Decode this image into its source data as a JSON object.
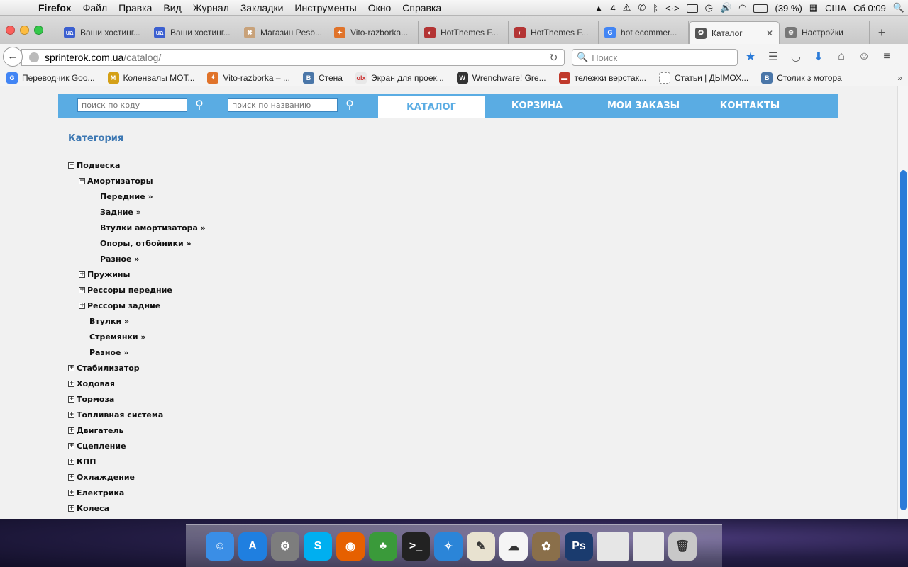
{
  "menubar": {
    "app": "Firefox",
    "items": [
      "Файл",
      "Правка",
      "Вид",
      "Журнал",
      "Закладки",
      "Инструменты",
      "Окно",
      "Справка"
    ],
    "status": {
      "notif": "4",
      "battery": "(39 %)",
      "input": "США",
      "clock": "Сб 0:09"
    }
  },
  "tabs": [
    {
      "label": "Ваши хостинг...",
      "fav_text": "ua",
      "fav_color": "#3b5fd0"
    },
    {
      "label": "Ваши хостинг...",
      "fav_text": "ua",
      "fav_color": "#3b5fd0"
    },
    {
      "label": "Магазин Pesb...",
      "fav_text": "✖",
      "fav_color": "#c8a27a"
    },
    {
      "label": "Vito-razborka...",
      "fav_text": "✦",
      "fav_color": "#e0732a"
    },
    {
      "label": "HotThemes F...",
      "fav_text": "◐",
      "fav_color": "#b33434"
    },
    {
      "label": "HotThemes F...",
      "fav_text": "◐",
      "fav_color": "#b33434"
    },
    {
      "label": "hot ecommer...",
      "fav_text": "G",
      "fav_color": "#4285f4"
    },
    {
      "label": "Каталог",
      "fav_text": "✪",
      "fav_color": "#555555",
      "active": true
    },
    {
      "label": "Настройки",
      "fav_text": "⚙",
      "fav_color": "#777777"
    }
  ],
  "navbar": {
    "url_host": "sprinterok.com.ua",
    "url_path": "/catalog/",
    "search_placeholder": "Поиск"
  },
  "bookmarks": [
    {
      "label": "Переводчик Goo...",
      "fav_text": "G",
      "fav_color": "#4285f4"
    },
    {
      "label": "Коленвалы МОТ...",
      "fav_text": "M",
      "fav_color": "#d4a017"
    },
    {
      "label": "Vito-razborka – ...",
      "fav_text": "✦",
      "fav_color": "#e0732a"
    },
    {
      "label": "Стена",
      "fav_text": "B",
      "fav_color": "#4a76a8"
    },
    {
      "label": "Экран для проек...",
      "fav_text": "olx",
      "fav_color": "#e8e8e8"
    },
    {
      "label": "Wrenchware! Gre...",
      "fav_text": "W",
      "fav_color": "#333333"
    },
    {
      "label": "тележки верстак...",
      "fav_text": "▬",
      "fav_color": "#c0392b"
    },
    {
      "label": "Статьи | ДЫМОХ...",
      "fav_text": "",
      "fav_color": "#ffffff"
    },
    {
      "label": "Столик з мотора",
      "fav_text": "B",
      "fav_color": "#4a76a8"
    }
  ],
  "site": {
    "search_code_placeholder": "поиск по коду",
    "search_name_placeholder": "поиск по названию",
    "nav": [
      "КАТАЛОГ",
      "КОРЗИНА",
      "МОИ ЗАКАЗЫ",
      "КОНТАКТЫ"
    ],
    "category_title": "Категория"
  },
  "tree": [
    {
      "label": "Подвеска",
      "level": 0,
      "toggle": "minus"
    },
    {
      "label": "Амортизаторы",
      "level": 1,
      "toggle": "minus"
    },
    {
      "label": "Передние »",
      "level": 2,
      "toggle": ""
    },
    {
      "label": "Задние »",
      "level": 2,
      "toggle": ""
    },
    {
      "label": "Втулки амортизатора »",
      "level": 2,
      "toggle": ""
    },
    {
      "label": "Опоры, отбойники »",
      "level": 2,
      "toggle": ""
    },
    {
      "label": "Разное »",
      "level": 2,
      "toggle": ""
    },
    {
      "label": "Пружины",
      "level": 1,
      "toggle": "plus"
    },
    {
      "label": "Рессоры передние",
      "level": 1,
      "toggle": "plus"
    },
    {
      "label": "Рессоры задние",
      "level": 1,
      "toggle": "plus"
    },
    {
      "label": "Втулки »",
      "level": 1.5,
      "toggle": ""
    },
    {
      "label": "Стремянки »",
      "level": 1.5,
      "toggle": ""
    },
    {
      "label": "Разное »",
      "level": 1.5,
      "toggle": ""
    },
    {
      "label": "Стабилизатор",
      "level": 0,
      "toggle": "plus"
    },
    {
      "label": "Ходовая",
      "level": 0,
      "toggle": "plus"
    },
    {
      "label": "Тормоза",
      "level": 0,
      "toggle": "plus"
    },
    {
      "label": "Топливная система",
      "level": 0,
      "toggle": "plus"
    },
    {
      "label": "Двигатель",
      "level": 0,
      "toggle": "plus"
    },
    {
      "label": "Сцепление",
      "level": 0,
      "toggle": "plus"
    },
    {
      "label": "КПП",
      "level": 0,
      "toggle": "plus"
    },
    {
      "label": "Охлаждение",
      "level": 0,
      "toggle": "plus"
    },
    {
      "label": "Електрика",
      "level": 0,
      "toggle": "plus"
    },
    {
      "label": "Колеса",
      "level": 0,
      "toggle": "plus"
    }
  ],
  "dock": [
    {
      "name": "finder",
      "glyph": "☺",
      "color": "#3a8ee6"
    },
    {
      "name": "app-store",
      "glyph": "A",
      "color": "#1f7fe0"
    },
    {
      "name": "system-preferences",
      "glyph": "⚙",
      "color": "#7d7d7d"
    },
    {
      "name": "skype",
      "glyph": "S",
      "color": "#00aff0"
    },
    {
      "name": "firefox",
      "glyph": "◉",
      "color": "#e66000"
    },
    {
      "name": "cyberduck",
      "glyph": "♣",
      "color": "#3a9a3a"
    },
    {
      "name": "terminal",
      "glyph": ">_",
      "color": "#222222"
    },
    {
      "name": "safari",
      "glyph": "✧",
      "color": "#2b85d8"
    },
    {
      "name": "textedit",
      "glyph": "✎",
      "color": "#e8e2d0"
    },
    {
      "name": "sheep",
      "glyph": "☁",
      "color": "#f5f5f5"
    },
    {
      "name": "preview",
      "glyph": "✿",
      "color": "#8a6f4a"
    },
    {
      "name": "photoshop",
      "glyph": "Ps",
      "color": "#1a3b6e"
    },
    {
      "name": "minimized-window-1",
      "glyph": "",
      "color": "#e6e6e6"
    },
    {
      "name": "minimized-window-2",
      "glyph": "",
      "color": "#e6e6e6"
    },
    {
      "name": "trash",
      "glyph": "🗑",
      "color": "#c8c8c8"
    }
  ]
}
